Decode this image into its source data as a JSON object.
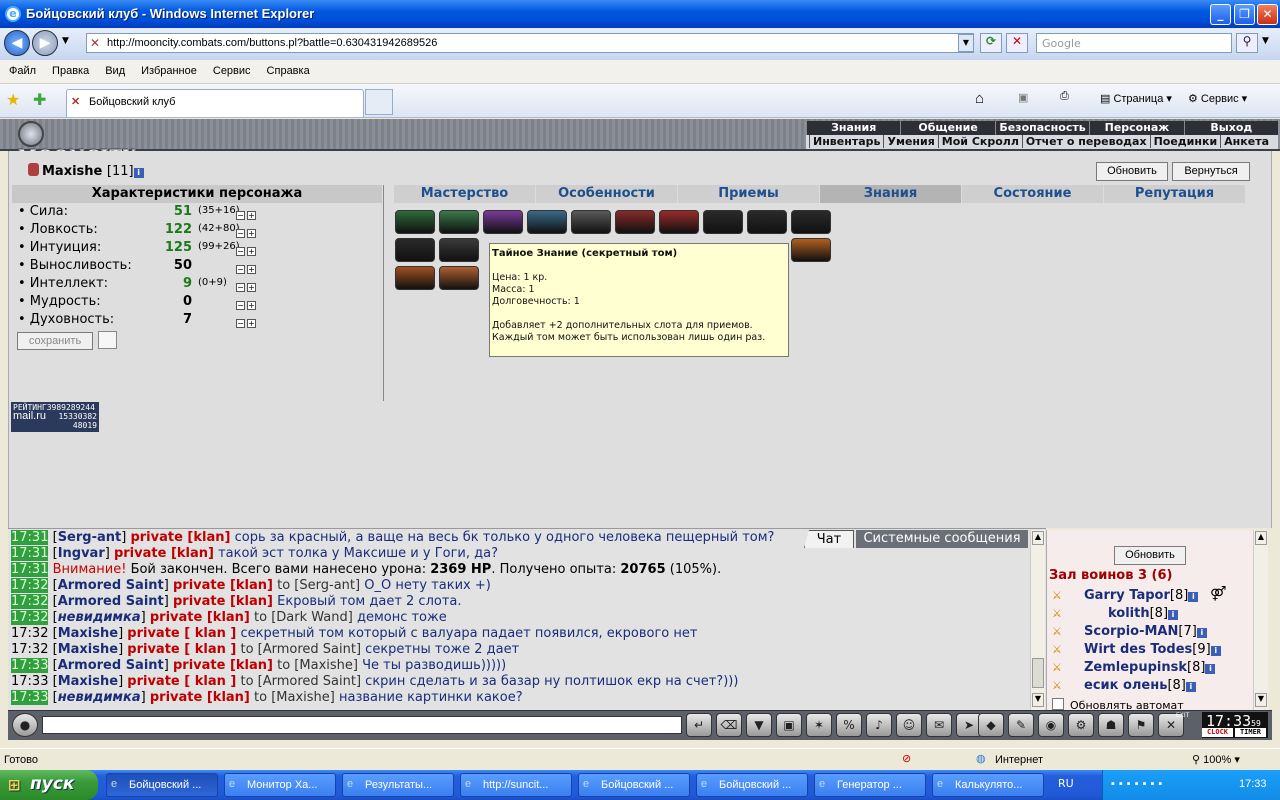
{
  "window": {
    "title": "Бойцовский клуб - Windows Internet Explorer"
  },
  "address": {
    "url": "http://mooncity.combats.com/buttons.pl?battle=0.630431942689526",
    "search_placeholder": "Google"
  },
  "menu": [
    "Файл",
    "Правка",
    "Вид",
    "Избранное",
    "Сервис",
    "Справка"
  ],
  "tab": {
    "title": "Бойцовский клуб",
    "page_label": "Страница",
    "service_label": "Сервис"
  },
  "game": {
    "logo": "MOONCITY",
    "topmenu": [
      "Знания",
      "Общение",
      "Безопасность",
      "Персонаж",
      "Выход"
    ],
    "submenu": [
      "Инвентарь",
      "Умения",
      "Мой Скролл",
      "Отчет о переводах",
      "Поединки",
      "Анкета"
    ]
  },
  "character": {
    "name": "Maxishe",
    "level": "[11]",
    "refresh_label": "Обновить",
    "back_label": "Вернуться"
  },
  "stats": {
    "title": "Характеристики персонажа",
    "rows": [
      {
        "name": "• Сила:",
        "value": "51",
        "bonus": "(35+16)",
        "color": "#1a7a1a"
      },
      {
        "name": "• Ловкость:",
        "value": "122",
        "bonus": "(42+80)",
        "color": "#1a7a1a"
      },
      {
        "name": "• Интуиция:",
        "value": "125",
        "bonus": "(99+26)",
        "color": "#1a7a1a"
      },
      {
        "name": "• Выносливость:",
        "value": "50",
        "bonus": "",
        "color": "#000000"
      },
      {
        "name": "• Интеллект:",
        "value": "9",
        "bonus": "(0+9)",
        "color": "#1a7a1a"
      },
      {
        "name": "• Мудрость:",
        "value": "0",
        "bonus": "",
        "color": "#000000"
      },
      {
        "name": "• Духовность:",
        "value": "7",
        "bonus": "",
        "color": "#000000"
      }
    ],
    "save_label": "сохранить"
  },
  "tabs": [
    "Мастерство",
    "Особенности",
    "Приемы",
    "Знания",
    "Состояние",
    "Репутация"
  ],
  "tooltip": {
    "title": "Тайное Знание (секретный том)",
    "price": "Цена: 1 кр.",
    "mass": "Масса: 1",
    "durability": "Долговечность: 1",
    "desc": "Добавляет +2 дополнительных слота для приемов. Каждый том может быть использован лишь один раз."
  },
  "rating": {
    "label": "РЕЙТИНГ",
    "n1": "3989289244",
    "brand": "mail.ru",
    "n2": "15330382",
    "n3": "48019"
  },
  "chat": {
    "tabs": [
      "Чат",
      "Системные сообщения"
    ],
    "lines": [
      {
        "time": "17:31",
        "green": true,
        "nick": "Serg-ant",
        "priv": "private [klan]",
        "to": "",
        "text": "сорь за красный, а ваще на весь бк только у одного человека пещерный том?"
      },
      {
        "time": "17:31",
        "green": true,
        "nick": "Ingvar",
        "priv": "private [klan]",
        "to": "",
        "text": "такой эст толка у Максише и у Гоги, да?"
      },
      {
        "time": "17:31",
        "green": true,
        "sys": true,
        "warn": "Внимание!",
        "text": "Бой закончен. Всего вами нанесено урона:",
        "dmg": "2369 HP",
        "text2": ". Получено опыта:",
        "exp": "20765",
        "text3": "(105%)."
      },
      {
        "time": "17:32",
        "green": true,
        "nick": "Armored Saint",
        "priv": "private [klan]",
        "to": "to [Serg-ant]",
        "text": "О_О нету таких +)"
      },
      {
        "time": "17:32",
        "green": true,
        "nick": "Armored Saint",
        "priv": "private [klan]",
        "to": "",
        "text": "Екровый том дает 2 слота."
      },
      {
        "time": "17:32",
        "green": true,
        "nick": "невидимка",
        "italic": true,
        "priv": "private [klan]",
        "to": "to [Dark Wand]",
        "text": "демонс тоже"
      },
      {
        "time": "17:32",
        "green": false,
        "nick": "Maxishe",
        "priv": "private [ klan ]",
        "to": "",
        "text": "секретный том который с валуара падает появился, екрового нет"
      },
      {
        "time": "17:32",
        "green": false,
        "nick": "Maxishe",
        "priv": "private [ klan ]",
        "to": "to [Armored Saint]",
        "text": "секретны тоже 2 дает"
      },
      {
        "time": "17:33",
        "green": true,
        "nick": "Armored Saint",
        "priv": "private [klan]",
        "to": "to [Maxishe]",
        "text": "Че ты разводишь)))))"
      },
      {
        "time": "17:33",
        "green": false,
        "nick": "Maxishe",
        "priv": "private [ klan ]",
        "to": "to [Armored Saint]",
        "text": "скрин сделать и за базар ну полтишок екр на счет?)))"
      },
      {
        "time": "17:33",
        "green": true,
        "nick": "невидимка",
        "italic": true,
        "priv": "private [klan]",
        "to": "to [Maxishe]",
        "text": "название картинки какое?"
      }
    ]
  },
  "hall": {
    "refresh_label": "Обновить",
    "name": "Зал воинов 3 (6)",
    "players": [
      {
        "name": "Garry Tapor",
        "level": "[8]"
      },
      {
        "name": "kolith",
        "level": "[8]"
      },
      {
        "name": "Scorpio-MAN",
        "level": "[7]"
      },
      {
        "name": "Wirt des Todes",
        "level": "[9]"
      },
      {
        "name": "Zemlepupinsk",
        "level": "[8]"
      },
      {
        "name": "есик олень",
        "level": "[8]"
      }
    ],
    "refresh_hint": "Обновлять автомат"
  },
  "clock": {
    "time": "17:33",
    "sec": "59",
    "label1": "CLOCK",
    "label2": "TIMER",
    "exit": "EXIT"
  },
  "status": {
    "text": "Готово",
    "zone": "Интернет",
    "zoom": "100%"
  },
  "taskbar": {
    "start": "пуск",
    "tasks": [
      "Бойцовский ...",
      "Монитор Ха...",
      "Результаты...",
      "http://suncit...",
      "Бойцовский ...",
      "Бойцовский ...",
      "Генератор ...",
      "Калькулято..."
    ],
    "lang": "RU",
    "time": "17:33"
  }
}
